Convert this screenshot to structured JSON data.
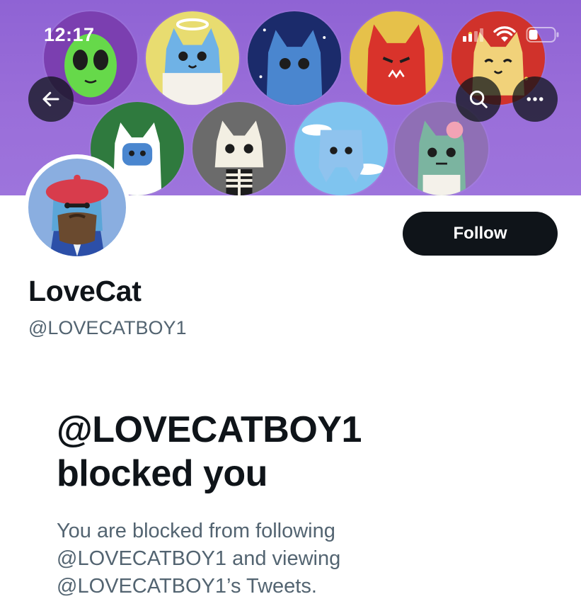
{
  "status_bar": {
    "time": "12:17",
    "icons": [
      "signal-icon",
      "wifi-icon",
      "battery-icon"
    ],
    "battery_level_percent": 30
  },
  "header": {
    "back_icon": "arrow-left-icon",
    "search_icon": "search-icon",
    "more_icon": "more-horizontal-icon"
  },
  "banner": {
    "background_color": "#9a6ed9",
    "cats": [
      {
        "name": "alien-cat",
        "bg": "#7b3fb0",
        "face": "#66d94a"
      },
      {
        "name": "angel-cat",
        "bg": "#e8dc70",
        "face": "#6fb2e6"
      },
      {
        "name": "space-cat",
        "bg": "#1b2b6b",
        "face": "#4a86cf"
      },
      {
        "name": "devil-cat",
        "bg": "#e6c14a",
        "face": "#d9332b"
      },
      {
        "name": "lucky-cat",
        "bg": "#d0322b",
        "face": "#f1d27a"
      },
      {
        "name": "robot-cat",
        "bg": "#2f7a3e",
        "face": "#ffffff"
      },
      {
        "name": "skeleton-cat",
        "bg": "#6b6b6b",
        "face": "#f3efe3"
      },
      {
        "name": "sky-cat",
        "bg": "#7fc4ef",
        "face": "#8fc3ee"
      },
      {
        "name": "zombie-cat",
        "bg": "#8f6fb5",
        "face": "#7bb4a0"
      }
    ]
  },
  "profile": {
    "display_name": "LoveCat",
    "handle": "@LOVECATBOY1",
    "follow_label": "Follow"
  },
  "blocked": {
    "title_line1": "@LOVECATBOY1",
    "title_line2": "blocked you",
    "desc_line1": "You are blocked from following",
    "desc_line2": "@LOVECATBOY1 and viewing",
    "desc_line3": "@LOVECATBOY1’s Tweets."
  },
  "colors": {
    "primary_text": "#0f1419",
    "secondary_text": "#536471",
    "follow_button": "#0f1419"
  }
}
